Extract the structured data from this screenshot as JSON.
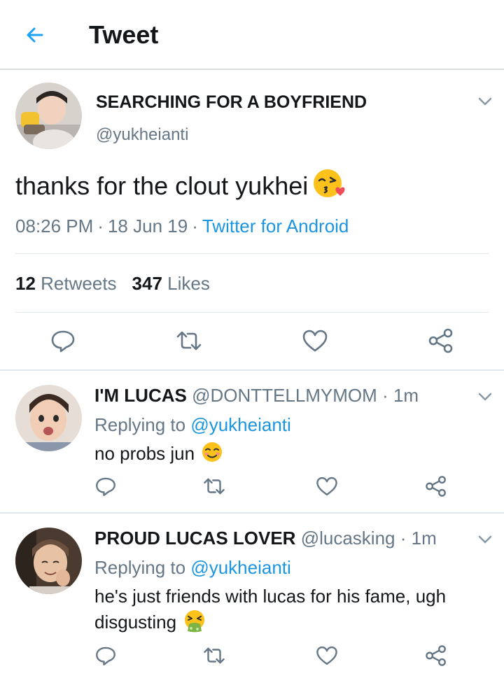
{
  "header": {
    "title": "Tweet",
    "back_icon": "arrow-left-icon"
  },
  "tweet": {
    "display_name": "SEARCHING FOR A BOYFRIEND",
    "handle": "@yukheianti",
    "text": "thanks for the clout yukhei",
    "emoji": "face-blowing-kiss-emoji",
    "time": "08:26 PM",
    "date": "18 Jun 19",
    "source": "Twitter for Android",
    "retweets_count": "12",
    "retweets_label": "Retweets",
    "likes_count": "347",
    "likes_label": "Likes"
  },
  "replies": [
    {
      "display_name": "I'M LUCAS",
      "handle": "@DONTTELLMYMOM",
      "time": "1m",
      "replying_prefix": "Replying to",
      "replying_to": "@yukheianti",
      "text": "no probs jun",
      "emoji": "smiling-face-emoji"
    },
    {
      "display_name": "PROUD LUCAS LOVER",
      "handle": "@lucasking",
      "time": "1m",
      "replying_prefix": "Replying to",
      "replying_to": "@yukheianti",
      "text_line1": "he's just friends with lucas for his fame, ugh",
      "text_line2": "disgusting",
      "emoji": "vomiting-face-emoji"
    }
  ],
  "colors": {
    "accent": "#1b95e0",
    "secondary_text": "#657786",
    "border": "#e1e8ed",
    "icon": "#657786"
  },
  "icons": [
    "reply-icon",
    "retweet-icon",
    "like-icon",
    "share-icon",
    "chevron-down-icon"
  ]
}
